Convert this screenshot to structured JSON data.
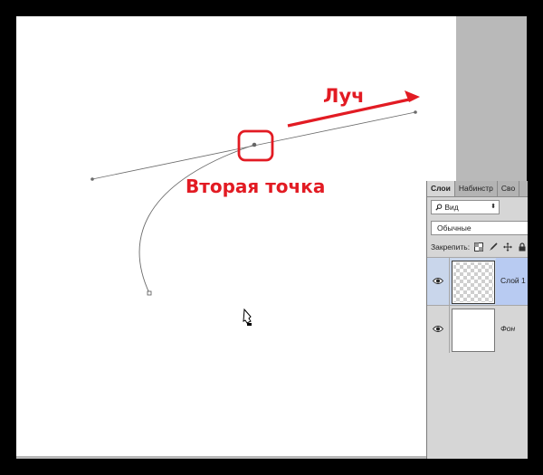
{
  "annotations": {
    "ray_label": "Луч",
    "second_point_label": "Вторая точка",
    "accent_color": "#e21b23"
  },
  "layers_panel": {
    "tabs": [
      {
        "label": "Слои",
        "active": true
      },
      {
        "label": "Набинстр",
        "active": false
      },
      {
        "label": "Сво",
        "active": false
      }
    ],
    "filter_select": {
      "value": "Вид"
    },
    "blend_mode": {
      "value": "Обычные"
    },
    "lock_label": "Закрепить:",
    "lock_icons": [
      "lock-transparent-icon",
      "lock-paint-icon",
      "lock-move-icon",
      "lock-all-icon"
    ],
    "layers": [
      {
        "name": "Слой 1",
        "visible": true,
        "selected": true,
        "thumbnail": "transparent"
      },
      {
        "name": "Фон",
        "visible": true,
        "selected": false,
        "thumbnail": "white"
      }
    ]
  },
  "icons": {
    "cursor": "pen-tool-cursor-icon",
    "eye": "eye-icon",
    "search": "search-icon"
  }
}
